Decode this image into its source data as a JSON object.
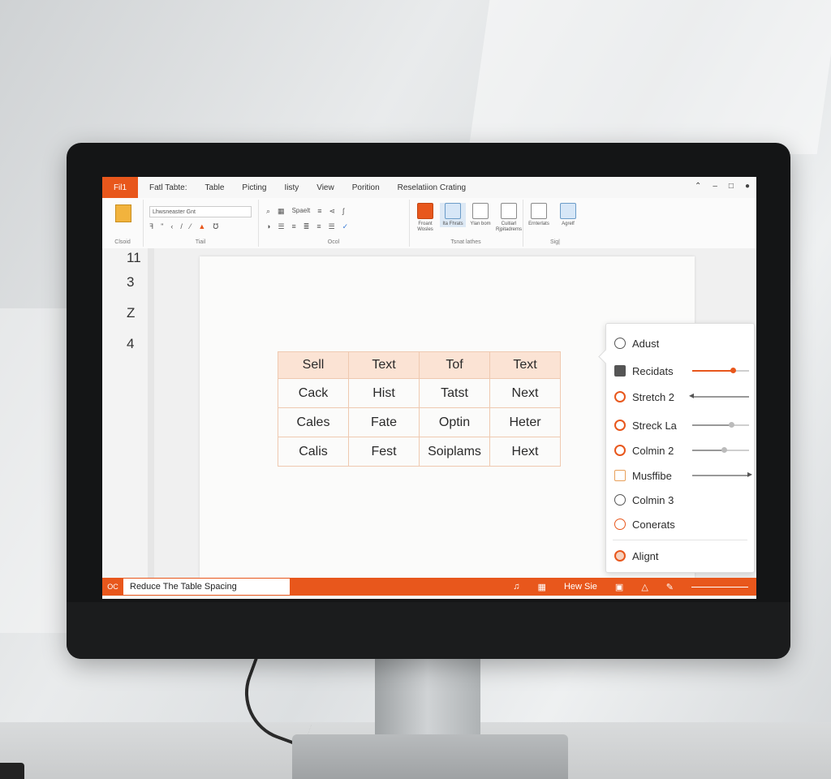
{
  "app": {
    "file_tab": "Fil1",
    "menus": [
      "Fatl Tabte:",
      "Table",
      "Picting",
      "Iisty",
      "View",
      "Porition",
      "Reselatiion Crating"
    ]
  },
  "ribbon": {
    "font_name": "Lhwsneaster Gnt",
    "style_label": "Spaelt",
    "groups": [
      "Clsoid",
      "Tiail",
      "Ocol",
      "Tsnat lathes",
      "Sig|"
    ],
    "big_buttons": [
      "Froant Wosles",
      "Ita Fhrats",
      "Ylan bom",
      "Cuitiarl Rjpitadrems",
      "Ernterlats",
      "Agrelf"
    ]
  },
  "rail": {
    "labels": [
      "11",
      "3",
      "Z",
      "4"
    ]
  },
  "table": {
    "header": [
      "Sell",
      "Text",
      "Tof",
      "Text"
    ],
    "rows": [
      [
        "Cack",
        "Hist",
        "Tatst",
        "Next"
      ],
      [
        "Cales",
        "Fate",
        "Optin",
        "Heter"
      ],
      [
        "Calis",
        "Fest",
        "Soiplams",
        "Hext"
      ]
    ]
  },
  "panel": {
    "items": [
      {
        "label": "Adust",
        "icon": "anchor-icon"
      },
      {
        "label": "Recidats",
        "icon": "tool-icon"
      },
      {
        "label": "Stretch 2",
        "icon": "stretch-icon"
      },
      {
        "label": "Streck La",
        "icon": "stretch-icon"
      },
      {
        "label": "Colmin 2",
        "icon": "column-icon"
      },
      {
        "label": "Musffibe",
        "icon": "list-icon"
      },
      {
        "label": "Colmin 3",
        "icon": "column-icon"
      },
      {
        "label": "Conerats",
        "icon": "check-icon"
      },
      {
        "label": "Alignt",
        "icon": "align-icon"
      }
    ],
    "slider_values": {
      "recidats": 0.72,
      "streck_la": 0.68,
      "colmin_2": 0.55
    }
  },
  "statusbar": {
    "left": "OC",
    "prompt_value": "Reduce The Table Spacing",
    "right_label": "Hew Sie"
  },
  "colors": {
    "accent": "#e8571c",
    "header_fill": "#fbe3d4",
    "cell_border": "#efc9b0"
  }
}
